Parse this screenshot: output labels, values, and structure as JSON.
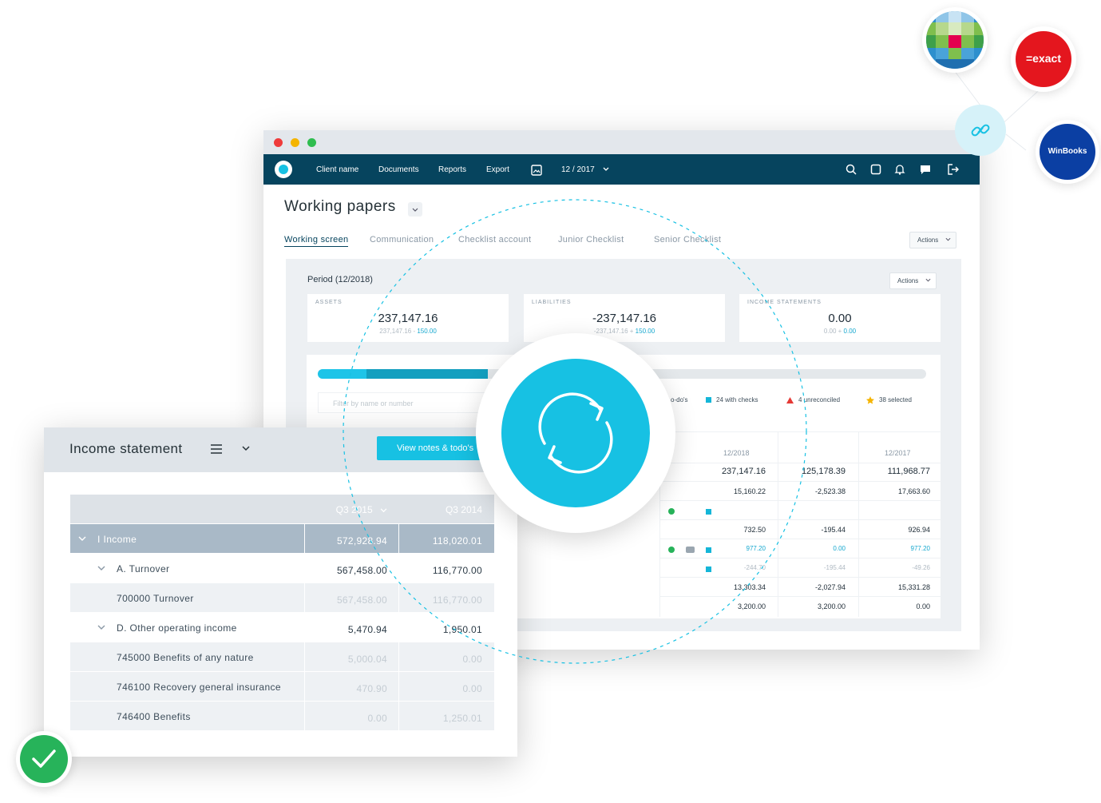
{
  "nav": {
    "items": [
      "Client name",
      "Documents",
      "Reports",
      "Export"
    ],
    "period": "12 / 2017"
  },
  "page": {
    "title": "Working papers",
    "tabs": [
      "Working screen",
      "Communication",
      "Checklist account",
      "Junior Checklist",
      "Senior Checklist"
    ],
    "actions_label": "Actions"
  },
  "panel": {
    "period": "Period (12/2018)",
    "actions_label": "Actions",
    "cards": [
      {
        "label": "ASSETS",
        "value": "237,147.16",
        "sub_a": "237,147.16 - ",
        "sub_b": "150.00"
      },
      {
        "label": "LIABILITIES",
        "value": "-237,147.16",
        "sub_a": "-237,147.16 + ",
        "sub_b": "150.00"
      },
      {
        "label": "INCOME STATEMENTS",
        "value": "0.00",
        "sub_a": "0.00 + ",
        "sub_b": "0.00"
      }
    ],
    "progress": {
      "primary": 0.08,
      "secondary": 0.2
    },
    "filter_placeholder": "Filter by name or number",
    "legend": {
      "todos": "o-do's",
      "checks": "24 with checks",
      "unreconciled": "4 unreconciled",
      "selected": "38 selected"
    },
    "columns": [
      "12/2018",
      "",
      "12/2017"
    ],
    "rows": [
      {
        "a": "237,147.16",
        "b": "125,178.39",
        "c": "111,968.77",
        "style": "big"
      },
      {
        "a": "15,160.22",
        "b": "-2,523.38",
        "c": "17,663.60",
        "style": "norm"
      },
      {
        "a": "",
        "b": "",
        "c": "",
        "style": "norm"
      },
      {
        "a": "732.50",
        "b": "-195.44",
        "c": "926.94",
        "style": "norm"
      },
      {
        "a": "977.20",
        "b": "0.00",
        "c": "977.20",
        "style": "link"
      },
      {
        "a": "-244.70",
        "b": "-195.44",
        "c": "-49.26",
        "style": "muted"
      },
      {
        "a": "13,303.34",
        "b": "-2,027.94",
        "c": "15,331.28",
        "style": "norm"
      },
      {
        "a": "3,200.00",
        "b": "3,200.00",
        "c": "0.00",
        "style": "norm"
      }
    ]
  },
  "integrations": {
    "exact": "=exact",
    "winbooks": "WinBooks"
  },
  "income": {
    "title": "Income statement",
    "button": "View notes & todo's",
    "columns": [
      "Q3 2015",
      "Q3 2014"
    ],
    "rows": [
      {
        "label": "I Income",
        "a": "572,928.94",
        "b": "118,020.01",
        "level": 0,
        "kind": "header"
      },
      {
        "label": "A. Turnover",
        "a": "567,458.00",
        "b": "116,770.00",
        "level": 1,
        "kind": "group"
      },
      {
        "label": "700000 Turnover",
        "a": "567,458.00",
        "b": "116,770.00",
        "level": 2,
        "kind": "leaf"
      },
      {
        "label": "D. Other operating income",
        "a": "5,470.94",
        "b": "1,950.01",
        "level": 1,
        "kind": "group"
      },
      {
        "label": "745000 Benefits of any nature",
        "a": "5,000.04",
        "b": "0.00",
        "level": 2,
        "kind": "leaf"
      },
      {
        "label": "746100 Recovery general insurance",
        "a": "470.90",
        "b": "0.00",
        "level": 2,
        "kind": "leaf"
      },
      {
        "label": "746400 Benefits",
        "a": "0.00",
        "b": "1,250.01",
        "level": 2,
        "kind": "leaf"
      }
    ]
  }
}
